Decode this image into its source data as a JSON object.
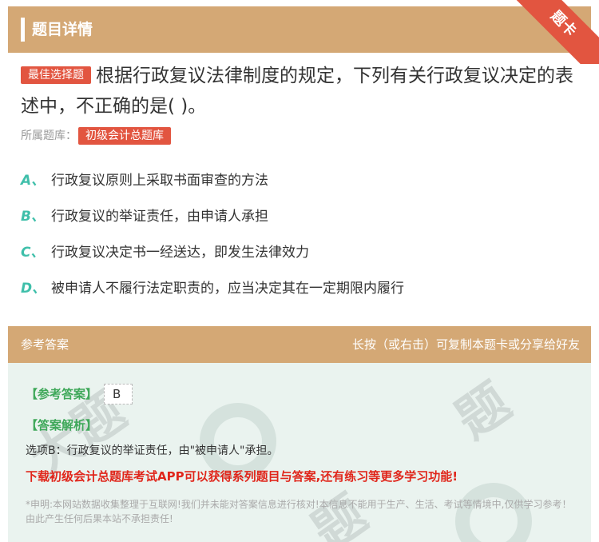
{
  "header": {
    "title": "题目详情",
    "corner_label": "题卡"
  },
  "question": {
    "badge": "最佳选择题",
    "text": "根据行政复议法律制度的规定，下列有关行政复议决定的表述中，不正确的是( )。",
    "library_label": "所属题库：",
    "library_tag": "初级会计总题库"
  },
  "options": [
    {
      "letter": "A、",
      "text": "行政复议原则上采取书面审查的方法"
    },
    {
      "letter": "B、",
      "text": "行政复议的举证责任，由申请人承担"
    },
    {
      "letter": "C、",
      "text": "行政复议决定书一经送达，即发生法律效力"
    },
    {
      "letter": "D、",
      "text": "被申请人不履行法定职责的，应当决定其在一定期限内履行"
    }
  ],
  "answer_section": {
    "title": "参考答案",
    "hint": "长按（或右击）可复制本题卡或分享给好友",
    "answer_label": "【参考答案】",
    "answer_value": "B",
    "analysis_label": "【答案解析】",
    "analysis_text": "选项B：行政复议的举证责任，由\"被申请人\"承担。",
    "promo": "下载初级会计总题库考试APP可以获得系列题目与答案,还有练习等更多学习功能!",
    "disclaimer": "*申明:本网站数据收集整理于互联网!我们并未能对答案信息进行核对!本信息不能用于生产、生活、考试等情境中,仅供学习参考！由此产生任何后果本站不承担责任!"
  },
  "colors": {
    "header_bg": "#d4a875",
    "accent_red": "#e25540",
    "option_letter": "#3fbfaa",
    "answer_bg": "#eaf3ef"
  }
}
